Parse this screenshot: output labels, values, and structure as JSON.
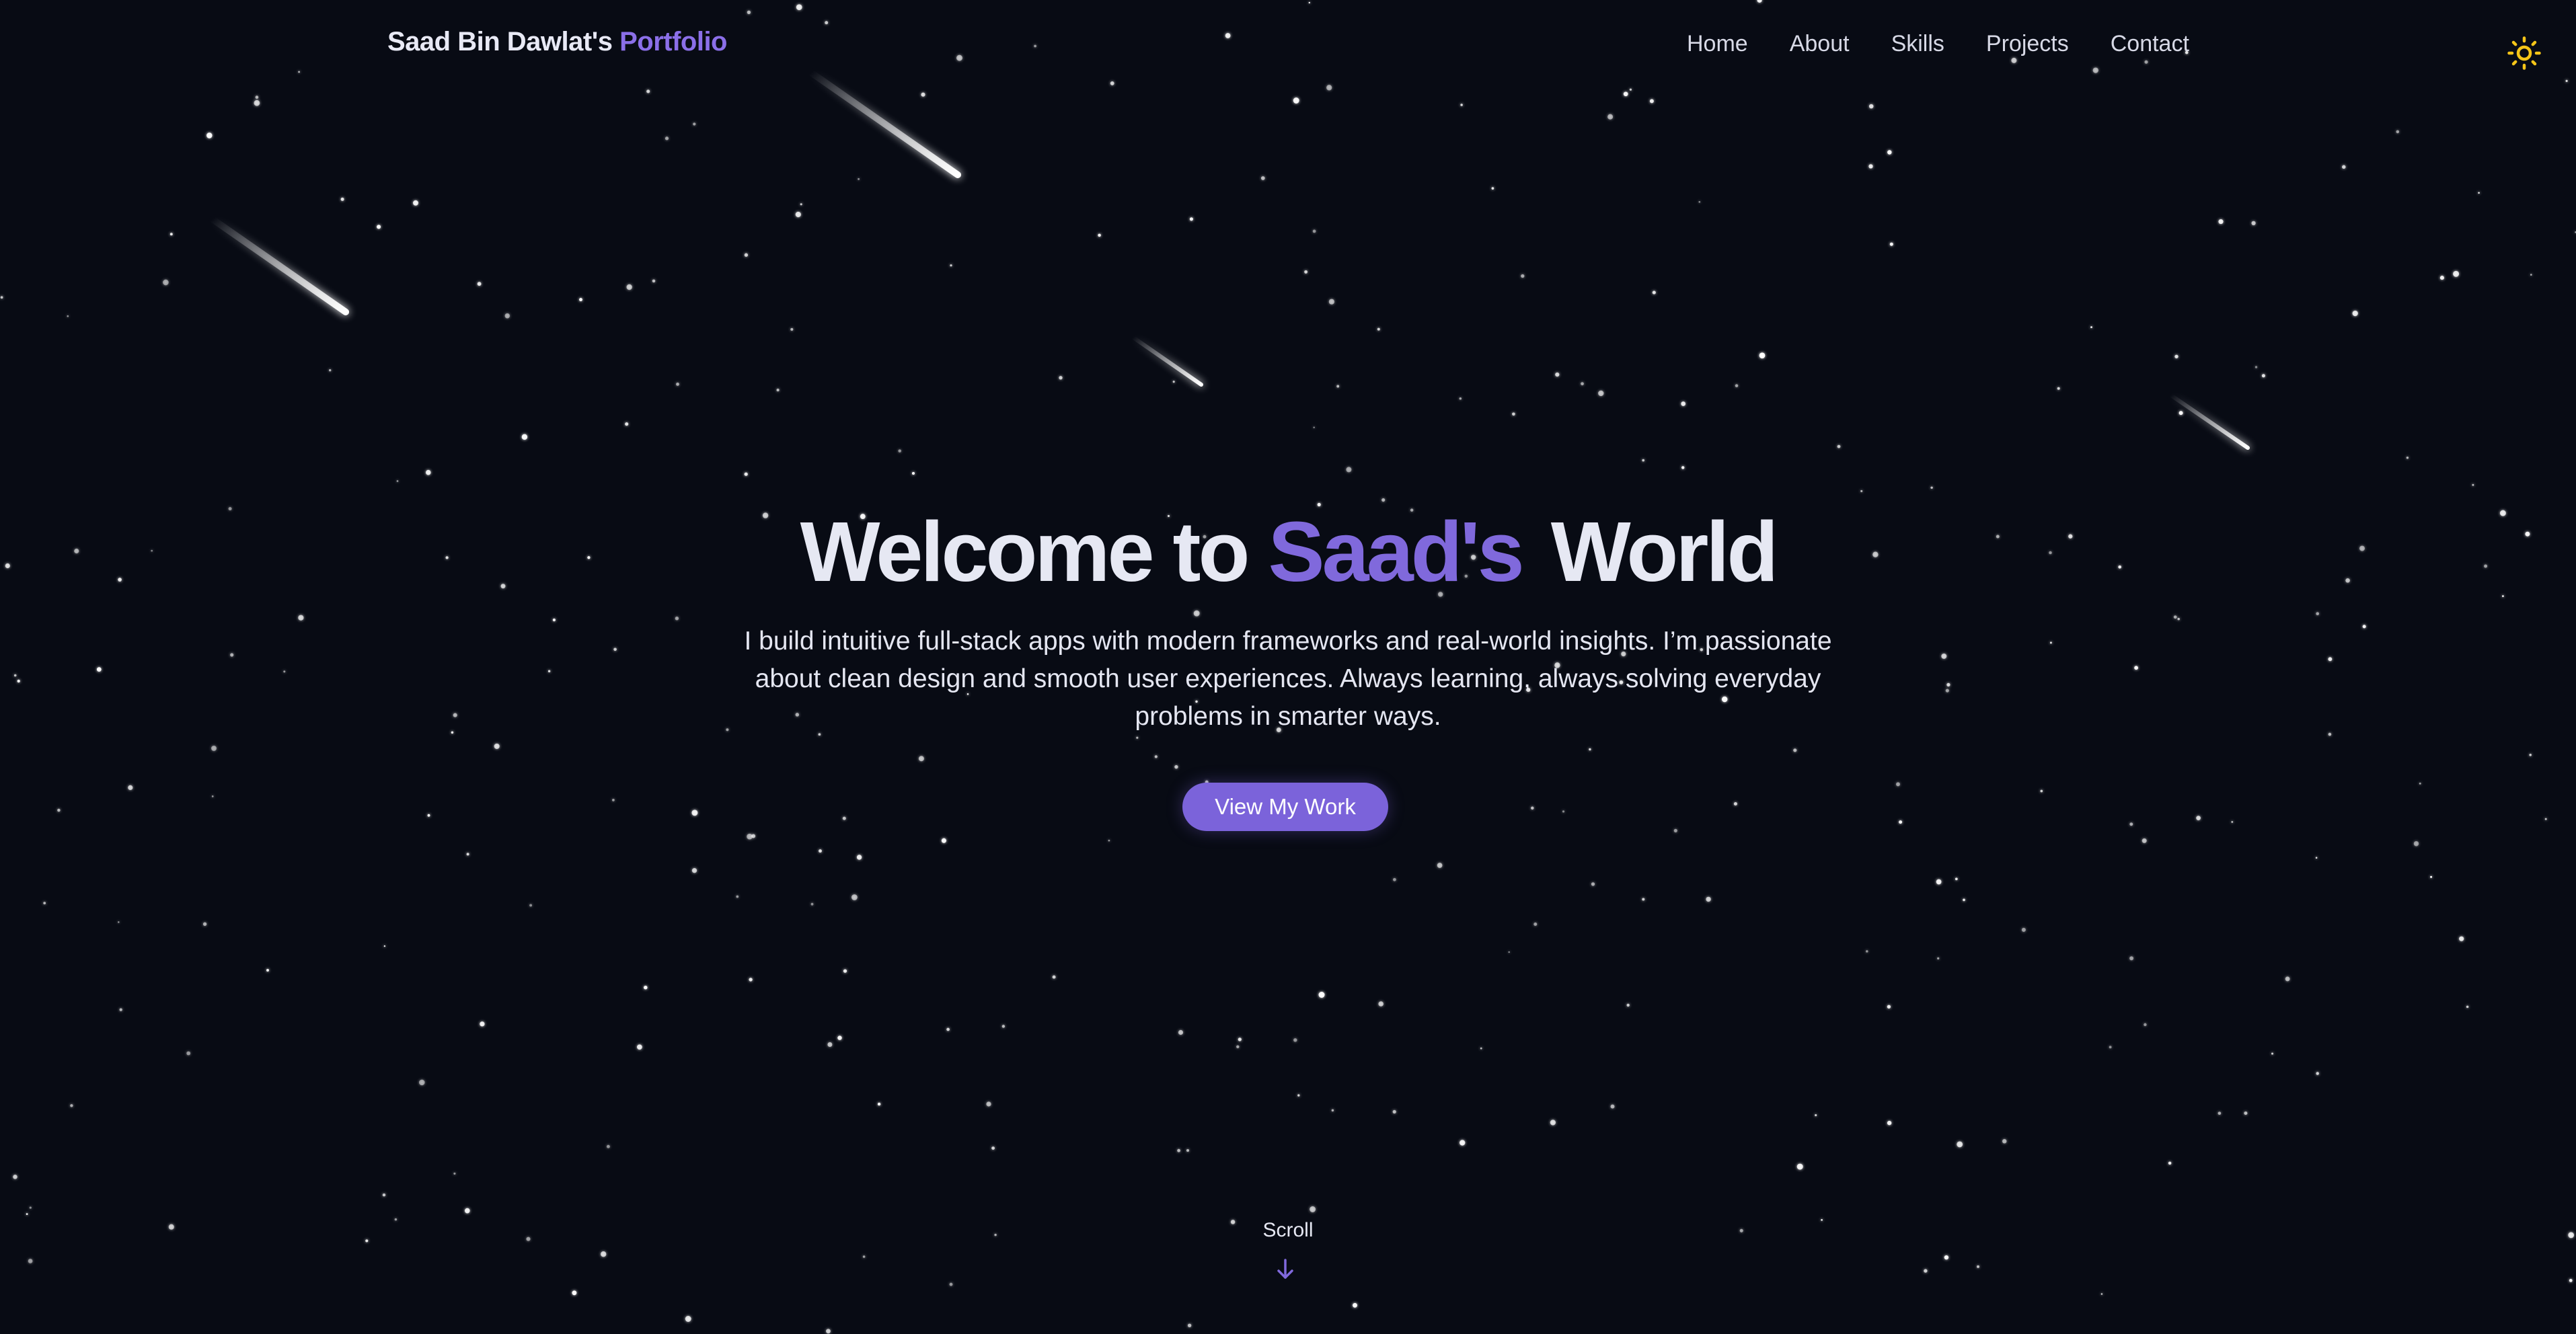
{
  "brand": {
    "name": "Saad Bin Dawlat's",
    "accent": "Portfolio"
  },
  "nav": {
    "items": [
      {
        "label": "Home"
      },
      {
        "label": "About"
      },
      {
        "label": "Skills"
      },
      {
        "label": "Projects"
      },
      {
        "label": "Contact"
      }
    ]
  },
  "theme_toggle": {
    "icon": "sun-icon",
    "color": "#f5c518"
  },
  "hero": {
    "title_prefix": "Welcome to",
    "title_accent": "Saad's",
    "title_suffix": "World",
    "subtitle_line1": "I build intuitive full-stack apps with modern frameworks and real-world insights. I’m passionate",
    "subtitle_line2": "about clean design and smooth user experiences. Always learning, always solving everyday",
    "subtitle_line3": "problems in smarter ways.",
    "cta_label": "View My Work"
  },
  "scroll": {
    "label": "Scroll",
    "icon": "arrow-down-icon"
  },
  "colors": {
    "background": "#080b14",
    "accent": "#8069dc",
    "text": "#e6e8f3",
    "button": "#7b63da"
  }
}
